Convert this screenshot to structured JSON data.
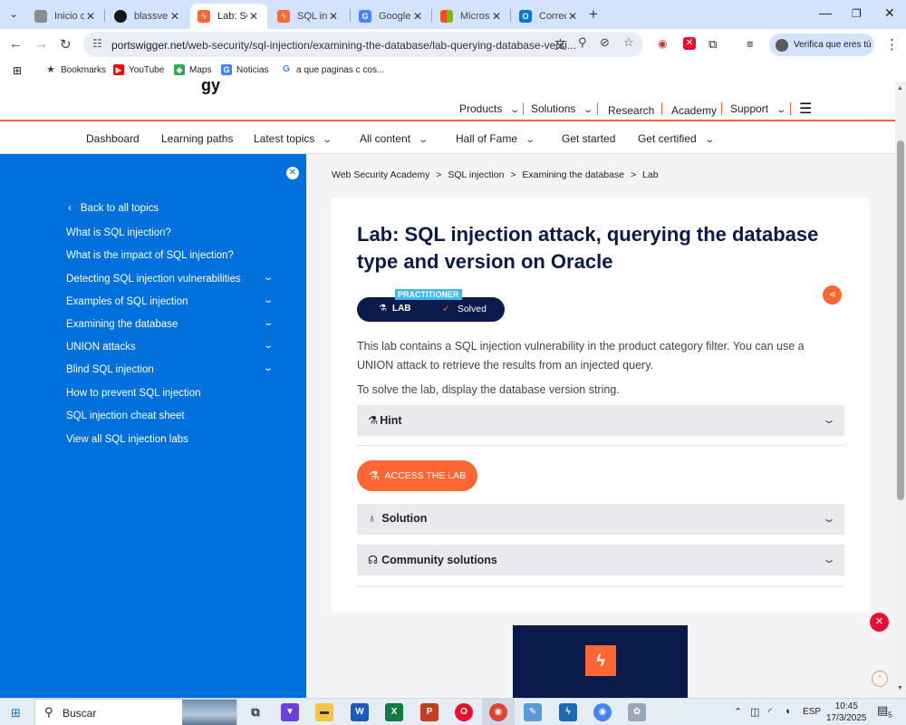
{
  "browser": {
    "tabs": [
      {
        "title": "Inicio de",
        "icon": "inicio-favicon",
        "color": "#8b8b8b"
      },
      {
        "title": "blassvel",
        "icon": "github-icon",
        "color": "#181717"
      },
      {
        "title": "Lab: SQL",
        "icon": "portswigger-icon",
        "color": "#ff6633",
        "active": true
      },
      {
        "title": "SQL inje",
        "icon": "portswigger-icon",
        "color": "#ff6633"
      },
      {
        "title": "Google",
        "icon": "google-translate-icon",
        "color": "#4285f4"
      },
      {
        "title": "Microso",
        "icon": "microsoft-icon",
        "color": "#f25022"
      },
      {
        "title": "Correo:",
        "icon": "outlook-icon",
        "color": "#0078d4"
      }
    ],
    "url_host": "portswigger.net",
    "url_path": "/web-security/sql-injection/examining-the-database/lab-querying-database-versi...",
    "profile_label": "Verifica que eres tú",
    "bookmarks": [
      {
        "label": "Bookmarks",
        "icon": "star-icon"
      },
      {
        "label": "YouTube",
        "icon": "youtube-icon",
        "color": "#ff0000"
      },
      {
        "label": "Maps",
        "icon": "maps-icon",
        "color": "#34a853"
      },
      {
        "label": "Noticias",
        "icon": "news-icon",
        "color": "#4285f4"
      },
      {
        "label": "a que paginas c cos...",
        "icon": "google-icon",
        "color": "#4285f4"
      }
    ]
  },
  "site": {
    "top_nav": [
      "Products",
      "Solutions",
      "Research",
      "Academy",
      "Support"
    ],
    "sub_nav": [
      "Dashboard",
      "Learning paths",
      "Latest topics",
      "All content",
      "Hall of Fame",
      "Get started",
      "Get certified"
    ],
    "accent": "#ff6633"
  },
  "sidebar": {
    "back": "Back to all topics",
    "items": [
      "What is SQL injection?",
      "What is the impact of SQL injection?",
      "Detecting SQL injection vulnerabilities",
      "Examples of SQL injection",
      "Examining the database",
      "UNION attacks",
      "Blind SQL injection",
      "How to prevent SQL injection",
      "SQL injection cheat sheet",
      "View all SQL injection labs"
    ],
    "bg": "#0071dc"
  },
  "breadcrumb": [
    "Web Security Academy",
    ">",
    "SQL injection",
    ">",
    "Examining the database",
    ">",
    "Lab"
  ],
  "lab": {
    "title": "Lab: SQL injection attack, querying the database type and version on Oracle",
    "level": "PRACTITIONER",
    "type": "LAB",
    "status": "Solved",
    "description": "This lab contains a SQL injection vulnerability in the product category filter. You can use a UNION attack to retrieve the results from an injected query.",
    "goal": "To solve the lab, display the database version string.",
    "hint": "Hint",
    "access_button": "ACCESS THE LAB",
    "solution": "Solution",
    "community": "Community solutions"
  },
  "taskbar": {
    "search_placeholder": "Buscar",
    "lang": "ESP",
    "time": "10:45",
    "date": "17/3/2025",
    "notifications": "5"
  }
}
